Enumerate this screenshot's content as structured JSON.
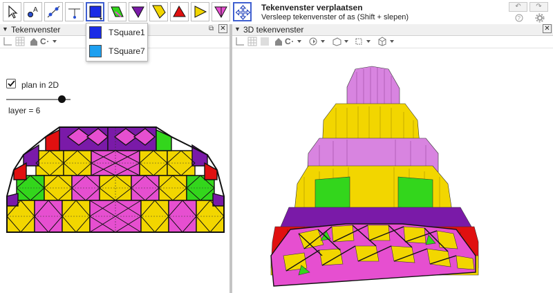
{
  "toolbar": {
    "tools": [
      {
        "name": "move"
      },
      {
        "name": "point"
      },
      {
        "name": "line"
      },
      {
        "name": "perpendicular"
      },
      {
        "name": "tsquare",
        "active": true
      },
      {
        "name": "parallelogram"
      },
      {
        "name": "purple-triangle"
      },
      {
        "name": "yellow-quad"
      },
      {
        "name": "red-triangle"
      },
      {
        "name": "yellow-triangle"
      },
      {
        "name": "pink-triangle"
      },
      {
        "name": "move-graphics-view",
        "active": true
      }
    ],
    "title": "Tekenvenster verplaatsen",
    "help": "Versleep tekenvenster of as (Shift + slepen)",
    "undo_label": "↶",
    "redo_label": "↷"
  },
  "dropdown": {
    "items": [
      {
        "label": "TSquare1",
        "color": "#1a2be6"
      },
      {
        "label": "TSquare7",
        "color": "#1ea0f0"
      }
    ]
  },
  "left_panel": {
    "title": "Tekenvenster",
    "checkbox_label": "plan in 2D",
    "checkbox_checked": true,
    "slider_value": 6,
    "layer_label": "layer = 6"
  },
  "right_panel": {
    "title": "3D tekenvenster"
  },
  "colors": {
    "yellow": "#f2d600",
    "magenta": "#e64fd0",
    "purple": "#7a1aa8",
    "red": "#e01010",
    "green": "#33d61c",
    "pink": "#ff77e8",
    "orchid": "#d884e0"
  }
}
